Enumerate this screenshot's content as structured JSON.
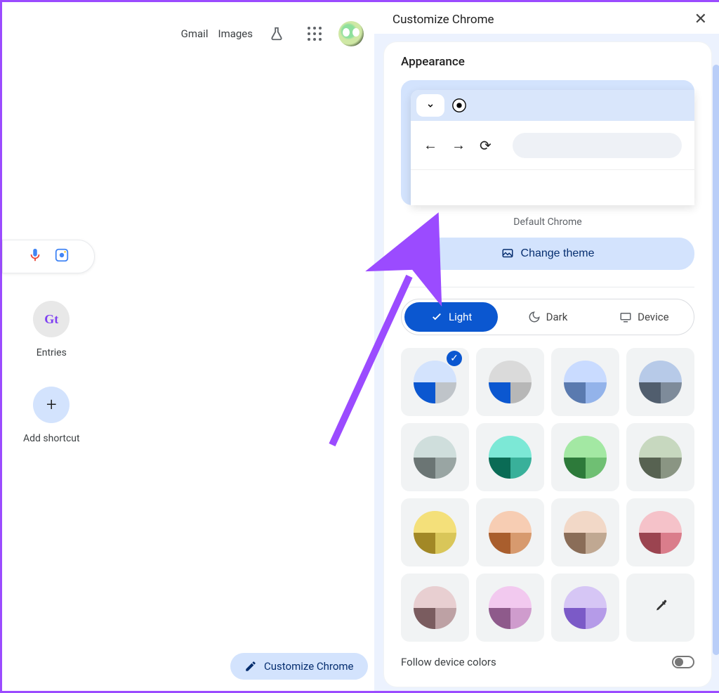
{
  "topnav": {
    "gmail": "Gmail",
    "images": "Images"
  },
  "shortcuts": {
    "entries": "Entries",
    "add": "Add shortcut"
  },
  "customize_pill": "Customize Chrome",
  "panel": {
    "title": "Customize Chrome",
    "section": "Appearance",
    "default_label": "Default Chrome",
    "change_theme": "Change theme",
    "modes": {
      "light": "Light",
      "dark": "Dark",
      "device": "Device"
    },
    "follow": "Follow device colors",
    "colors": [
      {
        "top": "#d3e3fd",
        "bl": "#0b57d0",
        "br": "#bfc4c9",
        "selected": true
      },
      {
        "top": "#dadada",
        "bl": "#0b57d0",
        "br": "#b7b7b7"
      },
      {
        "top": "#c9dbff",
        "bl": "#5a7aaf",
        "br": "#93b3ea"
      },
      {
        "top": "#b7cae8",
        "bl": "#515e6e",
        "br": "#7e8b9a"
      },
      {
        "top": "#cfdedc",
        "bl": "#6b7574",
        "br": "#99a5a3"
      },
      {
        "top": "#7ce8d6",
        "bl": "#0a6b55",
        "br": "#39b09a"
      },
      {
        "top": "#a3e8a3",
        "bl": "#2d7a3a",
        "br": "#6fbf73"
      },
      {
        "top": "#c7d8bf",
        "bl": "#576251",
        "br": "#8a9583"
      },
      {
        "top": "#f4e07a",
        "bl": "#a28826",
        "br": "#d9c659"
      },
      {
        "top": "#f7cdb3",
        "bl": "#a95e2d",
        "br": "#d79a6e"
      },
      {
        "top": "#f2d8c7",
        "bl": "#8a6d58",
        "br": "#c0a892"
      },
      {
        "top": "#f5c2c9",
        "bl": "#9b4450",
        "br": "#da7d8b"
      },
      {
        "top": "#e8cfd1",
        "bl": "#7a5c5f",
        "br": "#bda1a4"
      },
      {
        "top": "#f2c9ef",
        "bl": "#8e5a8b",
        "br": "#cf9ccd"
      },
      {
        "top": "#d6c6f5",
        "bl": "#7b5ac7",
        "br": "#b59be8"
      }
    ]
  }
}
